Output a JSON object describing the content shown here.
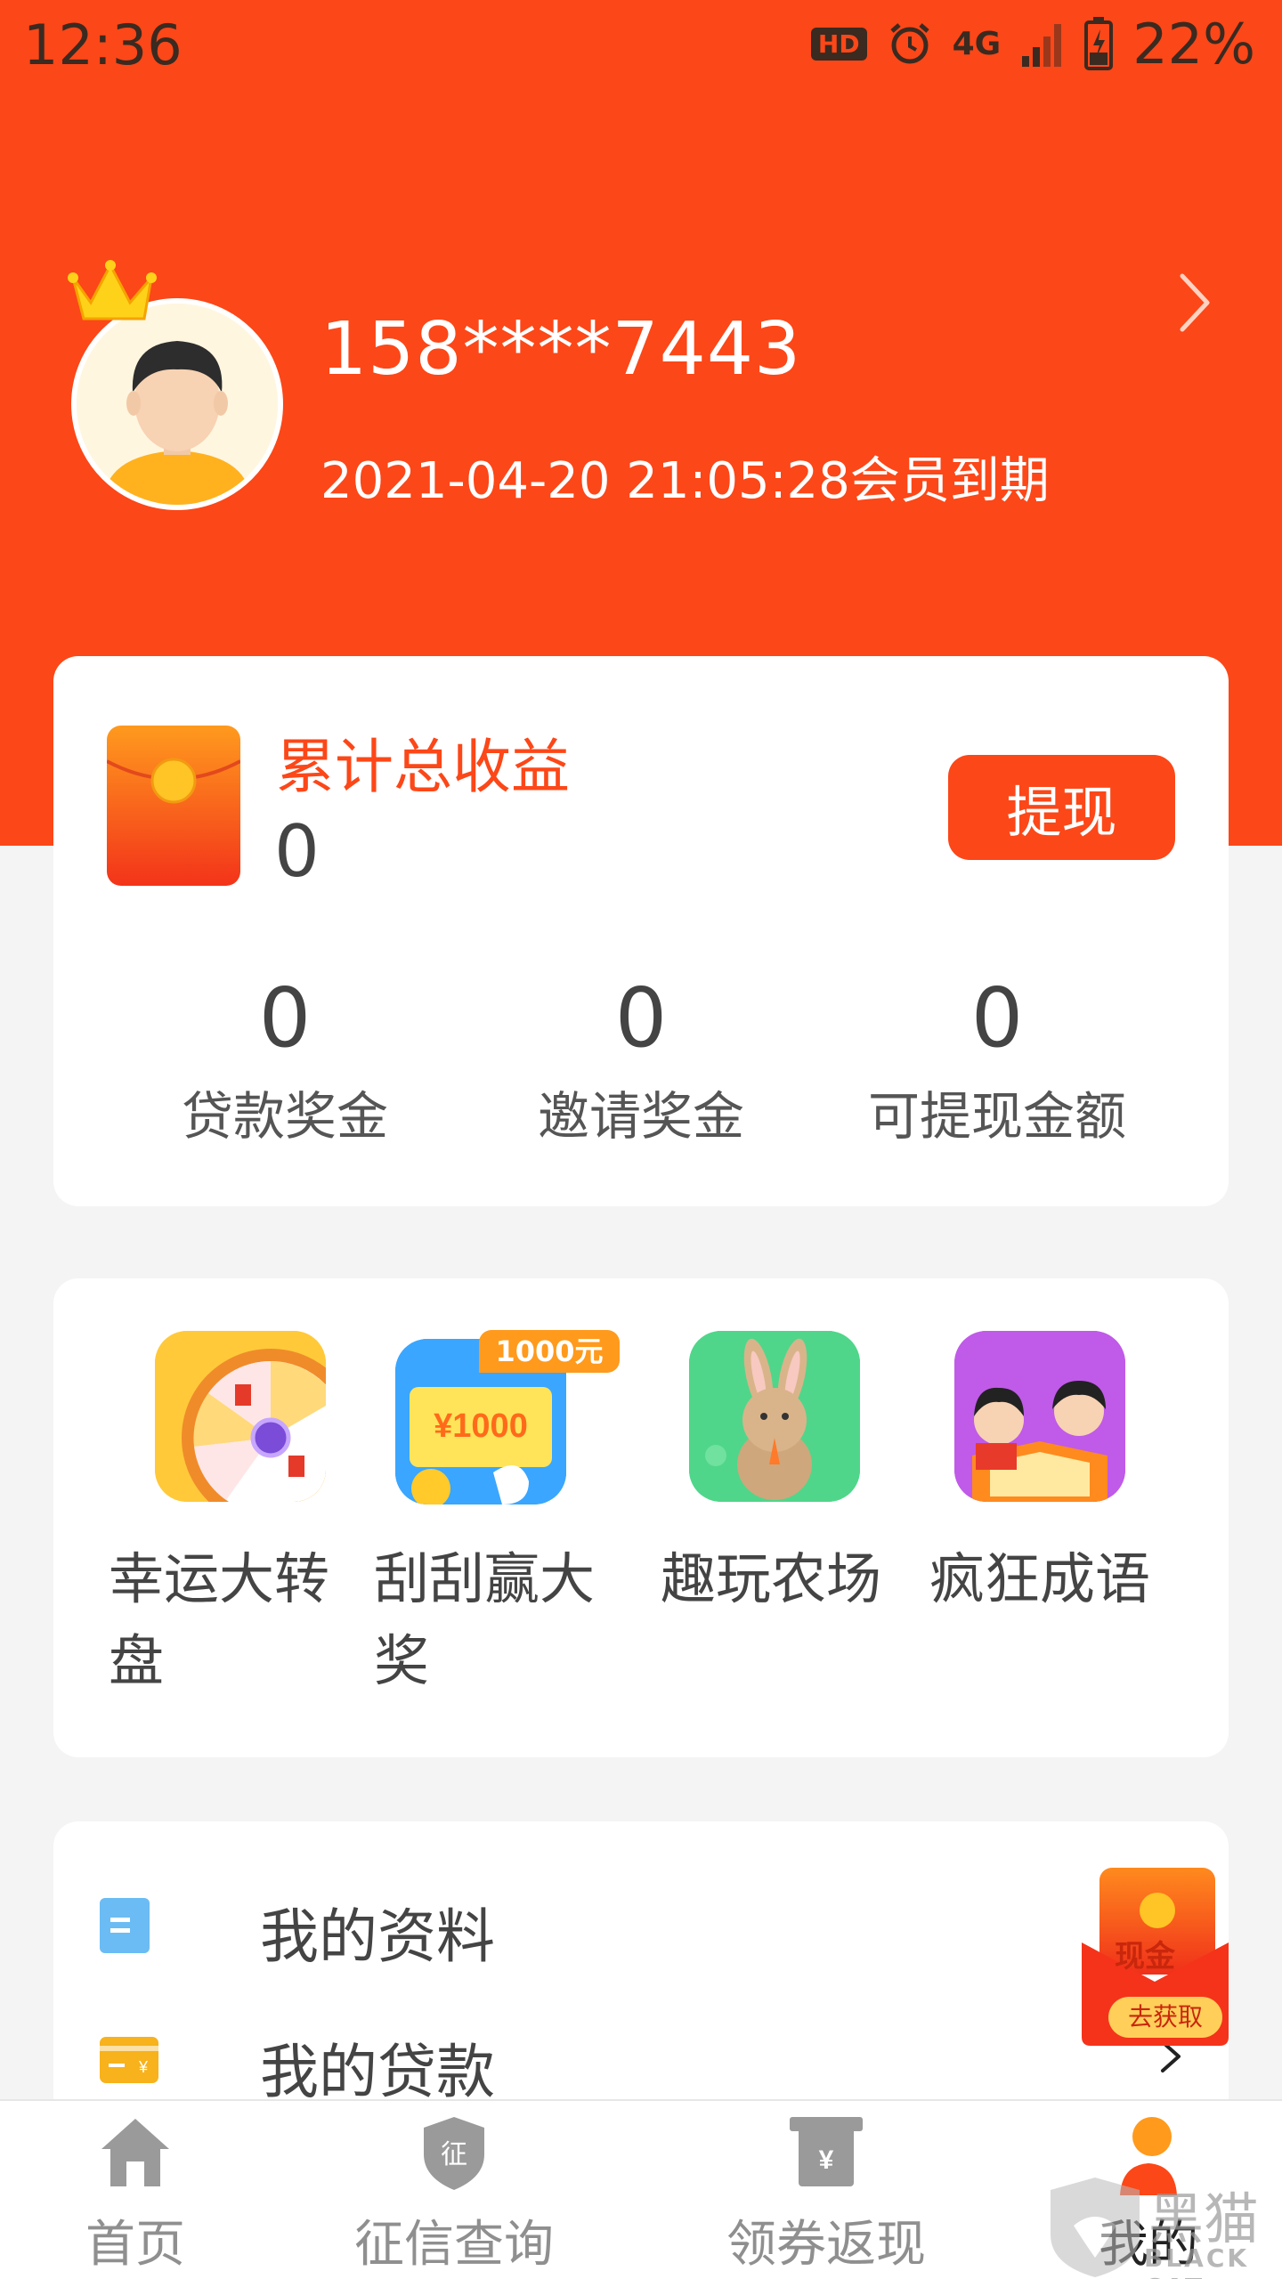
{
  "status_bar": {
    "time": "12:36",
    "hd_badge": "HD",
    "network": "4G",
    "battery_percent": "22%",
    "icons": [
      "hd-icon",
      "alarm-icon",
      "4g-icon",
      "signal-icon",
      "battery-icon"
    ]
  },
  "profile": {
    "phone": "158****7443",
    "expiry_text": "2021-04-20 21:05:28会员到期",
    "icons": [
      "crown-icon",
      "avatar-icon",
      "chevron-right-icon"
    ]
  },
  "earnings": {
    "title": "累计总收益",
    "total": "0",
    "withdraw_label": "提现",
    "stats": [
      {
        "value": "0",
        "label": "贷款奖金"
      },
      {
        "value": "0",
        "label": "邀请奖金"
      },
      {
        "value": "0",
        "label": "可提现金额"
      }
    ]
  },
  "games": {
    "items": [
      {
        "label_line1": "幸运大转",
        "label_line2": "盘",
        "icon": "wheel-icon"
      },
      {
        "label_line1": "刮刮赢大",
        "label_line2": "奖",
        "icon": "scratch-card-icon",
        "badge": "1000元",
        "icon_text": "¥1000"
      },
      {
        "label_line1": "趣玩农场",
        "label_line2": "",
        "icon": "rabbit-icon"
      },
      {
        "label_line1": "疯狂成语",
        "label_line2": "",
        "icon": "kids-reading-icon"
      }
    ]
  },
  "menu": {
    "items": [
      {
        "label": "我的资料",
        "icon": "document-icon"
      },
      {
        "label": "我的贷款",
        "icon": "card-icon"
      }
    ]
  },
  "promo": {
    "cash_label": "现金",
    "get_label": "去获取"
  },
  "bottom_nav": {
    "items": [
      {
        "label": "首页",
        "icon": "home-icon",
        "active": false
      },
      {
        "label": "征信查询",
        "icon": "shield-icon",
        "active": false,
        "icon_text": "征"
      },
      {
        "label": "领券返现",
        "icon": "coupon-icon",
        "active": false,
        "icon_text": "¥"
      },
      {
        "label": "我的",
        "icon": "person-icon",
        "active": true
      }
    ]
  },
  "watermark": {
    "text": "黑猫",
    "sub": "BLACK CAT"
  },
  "colors": {
    "brand": "#fc4718",
    "badge": "#ff9a1c",
    "blue": "#5aaaf0",
    "gold": "#f5b01c"
  }
}
